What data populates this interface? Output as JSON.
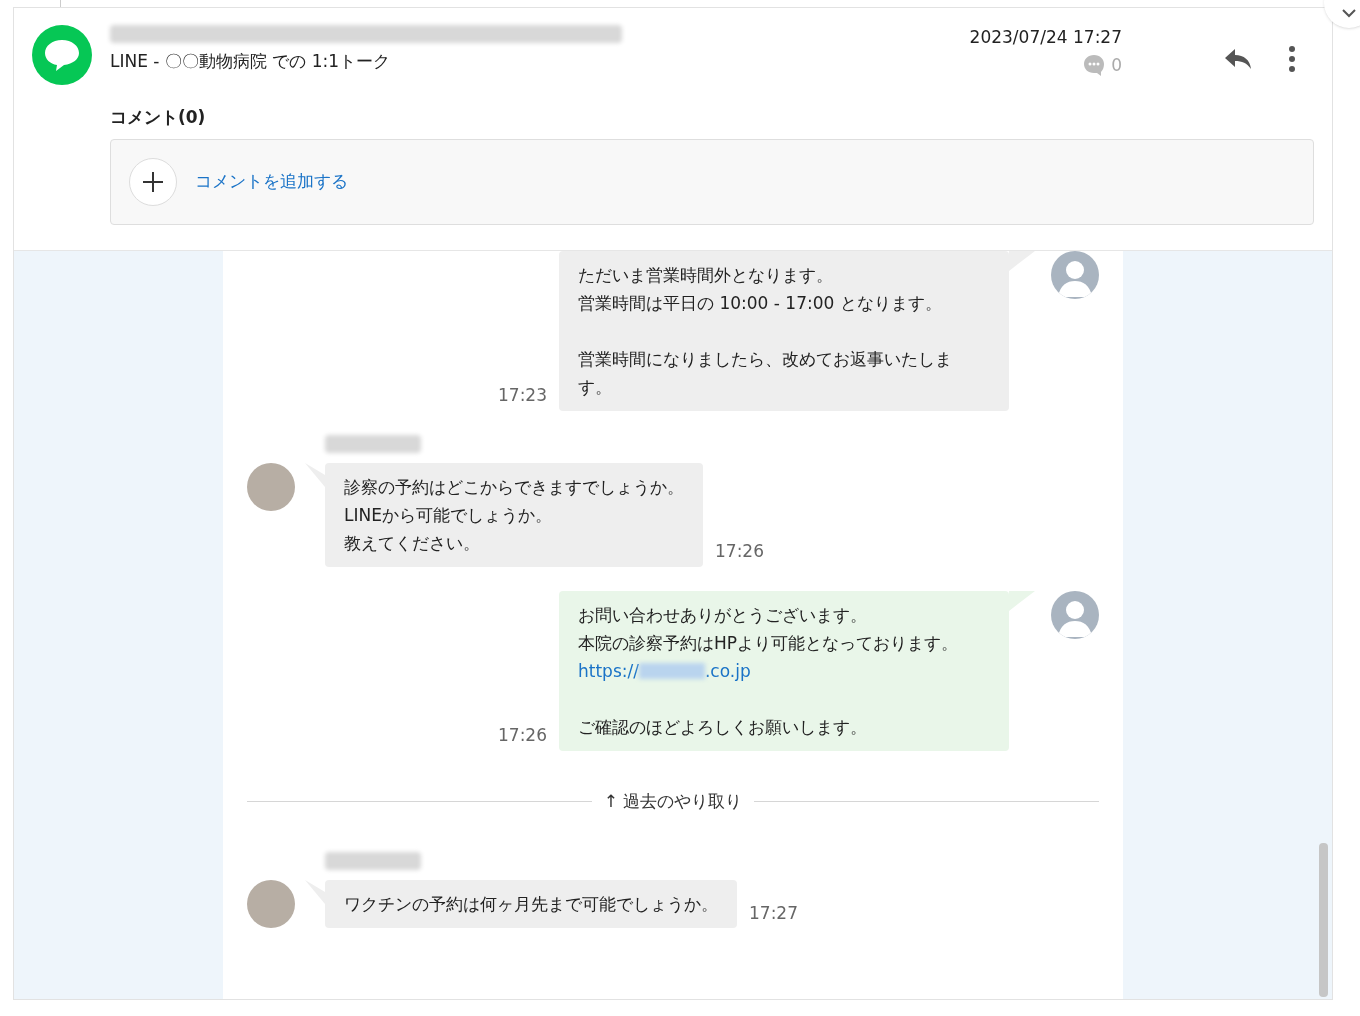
{
  "header": {
    "subtitle": "LINE - 〇〇動物病院 での 1:1トーク",
    "datetime": "2023/07/24 17:27",
    "comment_count": "0"
  },
  "comments": {
    "title": "コメント(0)",
    "add_label": "コメントを追加する"
  },
  "messages": [
    {
      "kind": "outgoing",
      "color": "#eeeeee",
      "time": "17:23",
      "blocks": [
        [
          {
            "kind": "text",
            "text": "ただいま営業時間外となります。"
          },
          {
            "kind": "text",
            "text": "営業時間は平日の 10:00 - 17:00 となります。"
          }
        ],
        [
          {
            "kind": "text",
            "text": "営業時間になりましたら、改めてお返事いたしま"
          },
          {
            "kind": "text",
            "text": "す。"
          }
        ]
      ]
    },
    {
      "kind": "incoming",
      "color": "#eeeeee",
      "time": "17:26",
      "blocks": [
        [
          {
            "kind": "text",
            "text": "診察の予約はどこからできますでしょうか。"
          },
          {
            "kind": "text",
            "text": "LINEから可能でしょうか。"
          },
          {
            "kind": "text",
            "text": "教えてください。"
          }
        ]
      ]
    },
    {
      "kind": "outgoing",
      "color": "#e9f6e9",
      "time": "17:26",
      "blocks": [
        [
          {
            "kind": "text",
            "text": "お問い合わせありがとうございます。"
          },
          {
            "kind": "text",
            "text": "本院の診察予約はHPより可能となっております。"
          },
          {
            "kind": "link",
            "head": "https://",
            "tail": ".co.jp"
          }
        ],
        [
          {
            "kind": "text",
            "text": "ご確認のほどよろしくお願いします。"
          }
        ]
      ]
    },
    {
      "kind": "divider",
      "text": "↑ 過去のやり取り"
    },
    {
      "kind": "incoming",
      "color": "#eeeeee",
      "time": "17:27",
      "blocks": [
        [
          {
            "kind": "text",
            "text": "ワクチンの予約は何ヶ月先まで可能でしょうか。"
          }
        ]
      ]
    }
  ]
}
